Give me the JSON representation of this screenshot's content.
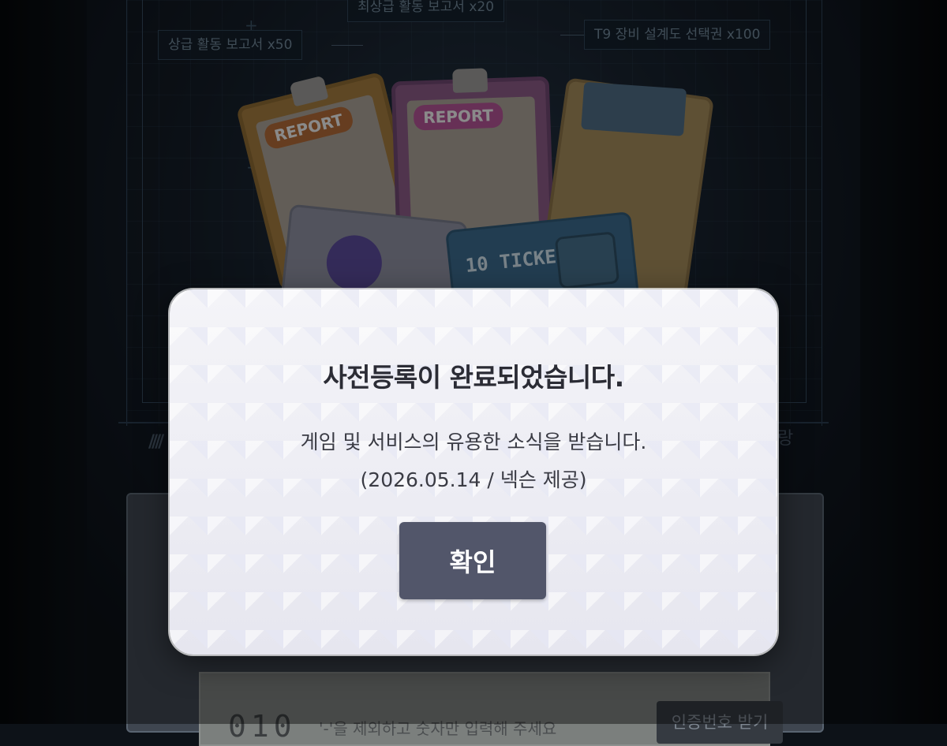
{
  "background": {
    "rewards": [
      {
        "label": "최상급 활동 보고서 x20"
      },
      {
        "label": "상급 활동 보고서 x50"
      },
      {
        "label": "T9 장비 설계도 선택권 x100"
      }
    ],
    "report_tag": "REPORT",
    "ticket_label": "10 TICKET",
    "side_text": "랑",
    "code_prefix": "010",
    "code_hint": "'-'을 제외하고 숫자만 입력해 주세요",
    "verify_button": "인증번호 받기"
  },
  "modal": {
    "title": "사전등록이 완료되었습니다.",
    "message_line1": "게임 및 서비스의 유용한 소식을 받습니다.",
    "message_line2": "(2026.05.14 / 넥슨 제공)",
    "confirm_label": "확인"
  }
}
